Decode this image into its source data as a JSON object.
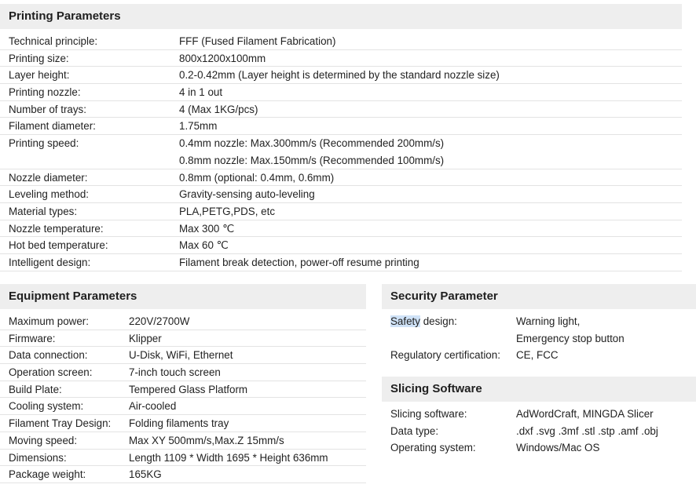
{
  "printing": {
    "title": "Printing Parameters",
    "rows": [
      {
        "label": "Technical principle:",
        "values": [
          "FFF (Fused Filament Fabrication)"
        ]
      },
      {
        "label": "Printing size:",
        "values": [
          "800x1200x100mm"
        ]
      },
      {
        "label": "Layer height:",
        "values": [
          "0.2-0.42mm (Layer height is determined by the standard nozzle size)"
        ]
      },
      {
        "label": "Printing nozzle:",
        "values": [
          "4 in 1 out"
        ]
      },
      {
        "label": "Number of trays:",
        "values": [
          "4 (Max 1KG/pcs)"
        ]
      },
      {
        "label": "Filament diameter:",
        "values": [
          "1.75mm"
        ]
      },
      {
        "label": "Printing speed:",
        "values": [
          "0.4mm nozzle: Max.300mm/s (Recommended 200mm/s)",
          "0.8mm nozzle: Max.150mm/s (Recommended 100mm/s)"
        ]
      },
      {
        "label": "Nozzle diameter:",
        "values": [
          "0.8mm (optional: 0.4mm, 0.6mm)"
        ]
      },
      {
        "label": "Leveling method:",
        "values": [
          "Gravity-sensing auto-leveling"
        ]
      },
      {
        "label": "Material types:",
        "values": [
          "PLA,PETG,PDS, etc"
        ]
      },
      {
        "label": "Nozzle temperature:",
        "values": [
          "Max 300 ℃"
        ]
      },
      {
        "label": "Hot bed temperature:",
        "values": [
          "Max 60 ℃"
        ]
      },
      {
        "label": "Intelligent design:",
        "values": [
          "Filament break detection, power-off resume printing"
        ]
      }
    ]
  },
  "equipment": {
    "title": "Equipment Parameters",
    "rows": [
      {
        "label": "Maximum power:",
        "values": [
          "220V/2700W"
        ]
      },
      {
        "label": "Firmware:",
        "values": [
          "Klipper"
        ]
      },
      {
        "label": "Data connection:",
        "values": [
          "U-Disk, WiFi, Ethernet"
        ]
      },
      {
        "label": "Operation screen:",
        "values": [
          "7-inch touch screen"
        ]
      },
      {
        "label": "Build Plate:",
        "values": [
          "Tempered Glass Platform"
        ]
      },
      {
        "label": "Cooling system:",
        "values": [
          "Air-cooled"
        ]
      },
      {
        "label": "Filament Tray Design:",
        "values": [
          "Folding filaments tray"
        ]
      },
      {
        "label": "Moving speed:",
        "values": [
          "Max XY 500mm/s,Max.Z 15mm/s"
        ]
      },
      {
        "label": "Dimensions:",
        "values": [
          "Length 1109 * Width 1695 * Height 636mm"
        ]
      },
      {
        "label": "Package weight:",
        "values": [
          "165KG"
        ]
      }
    ]
  },
  "security": {
    "title": "Security Parameter",
    "rows": [
      {
        "label_highlight": "Safety",
        "label_rest": " design:",
        "values": [
          "Warning light,",
          "Emergency stop button"
        ]
      },
      {
        "label": "Regulatory certification:",
        "values": [
          "CE, FCC"
        ]
      }
    ]
  },
  "slicing": {
    "title": "Slicing Software",
    "rows": [
      {
        "label": "Slicing software:",
        "values": [
          "AdWordCraft, MINGDA Slicer"
        ]
      },
      {
        "label": "Data type:",
        "values": [
          ".dxf .svg .3mf .stl .stp .amf .obj"
        ]
      },
      {
        "label": "Operating system:",
        "values": [
          "Windows/Mac OS"
        ]
      }
    ]
  }
}
